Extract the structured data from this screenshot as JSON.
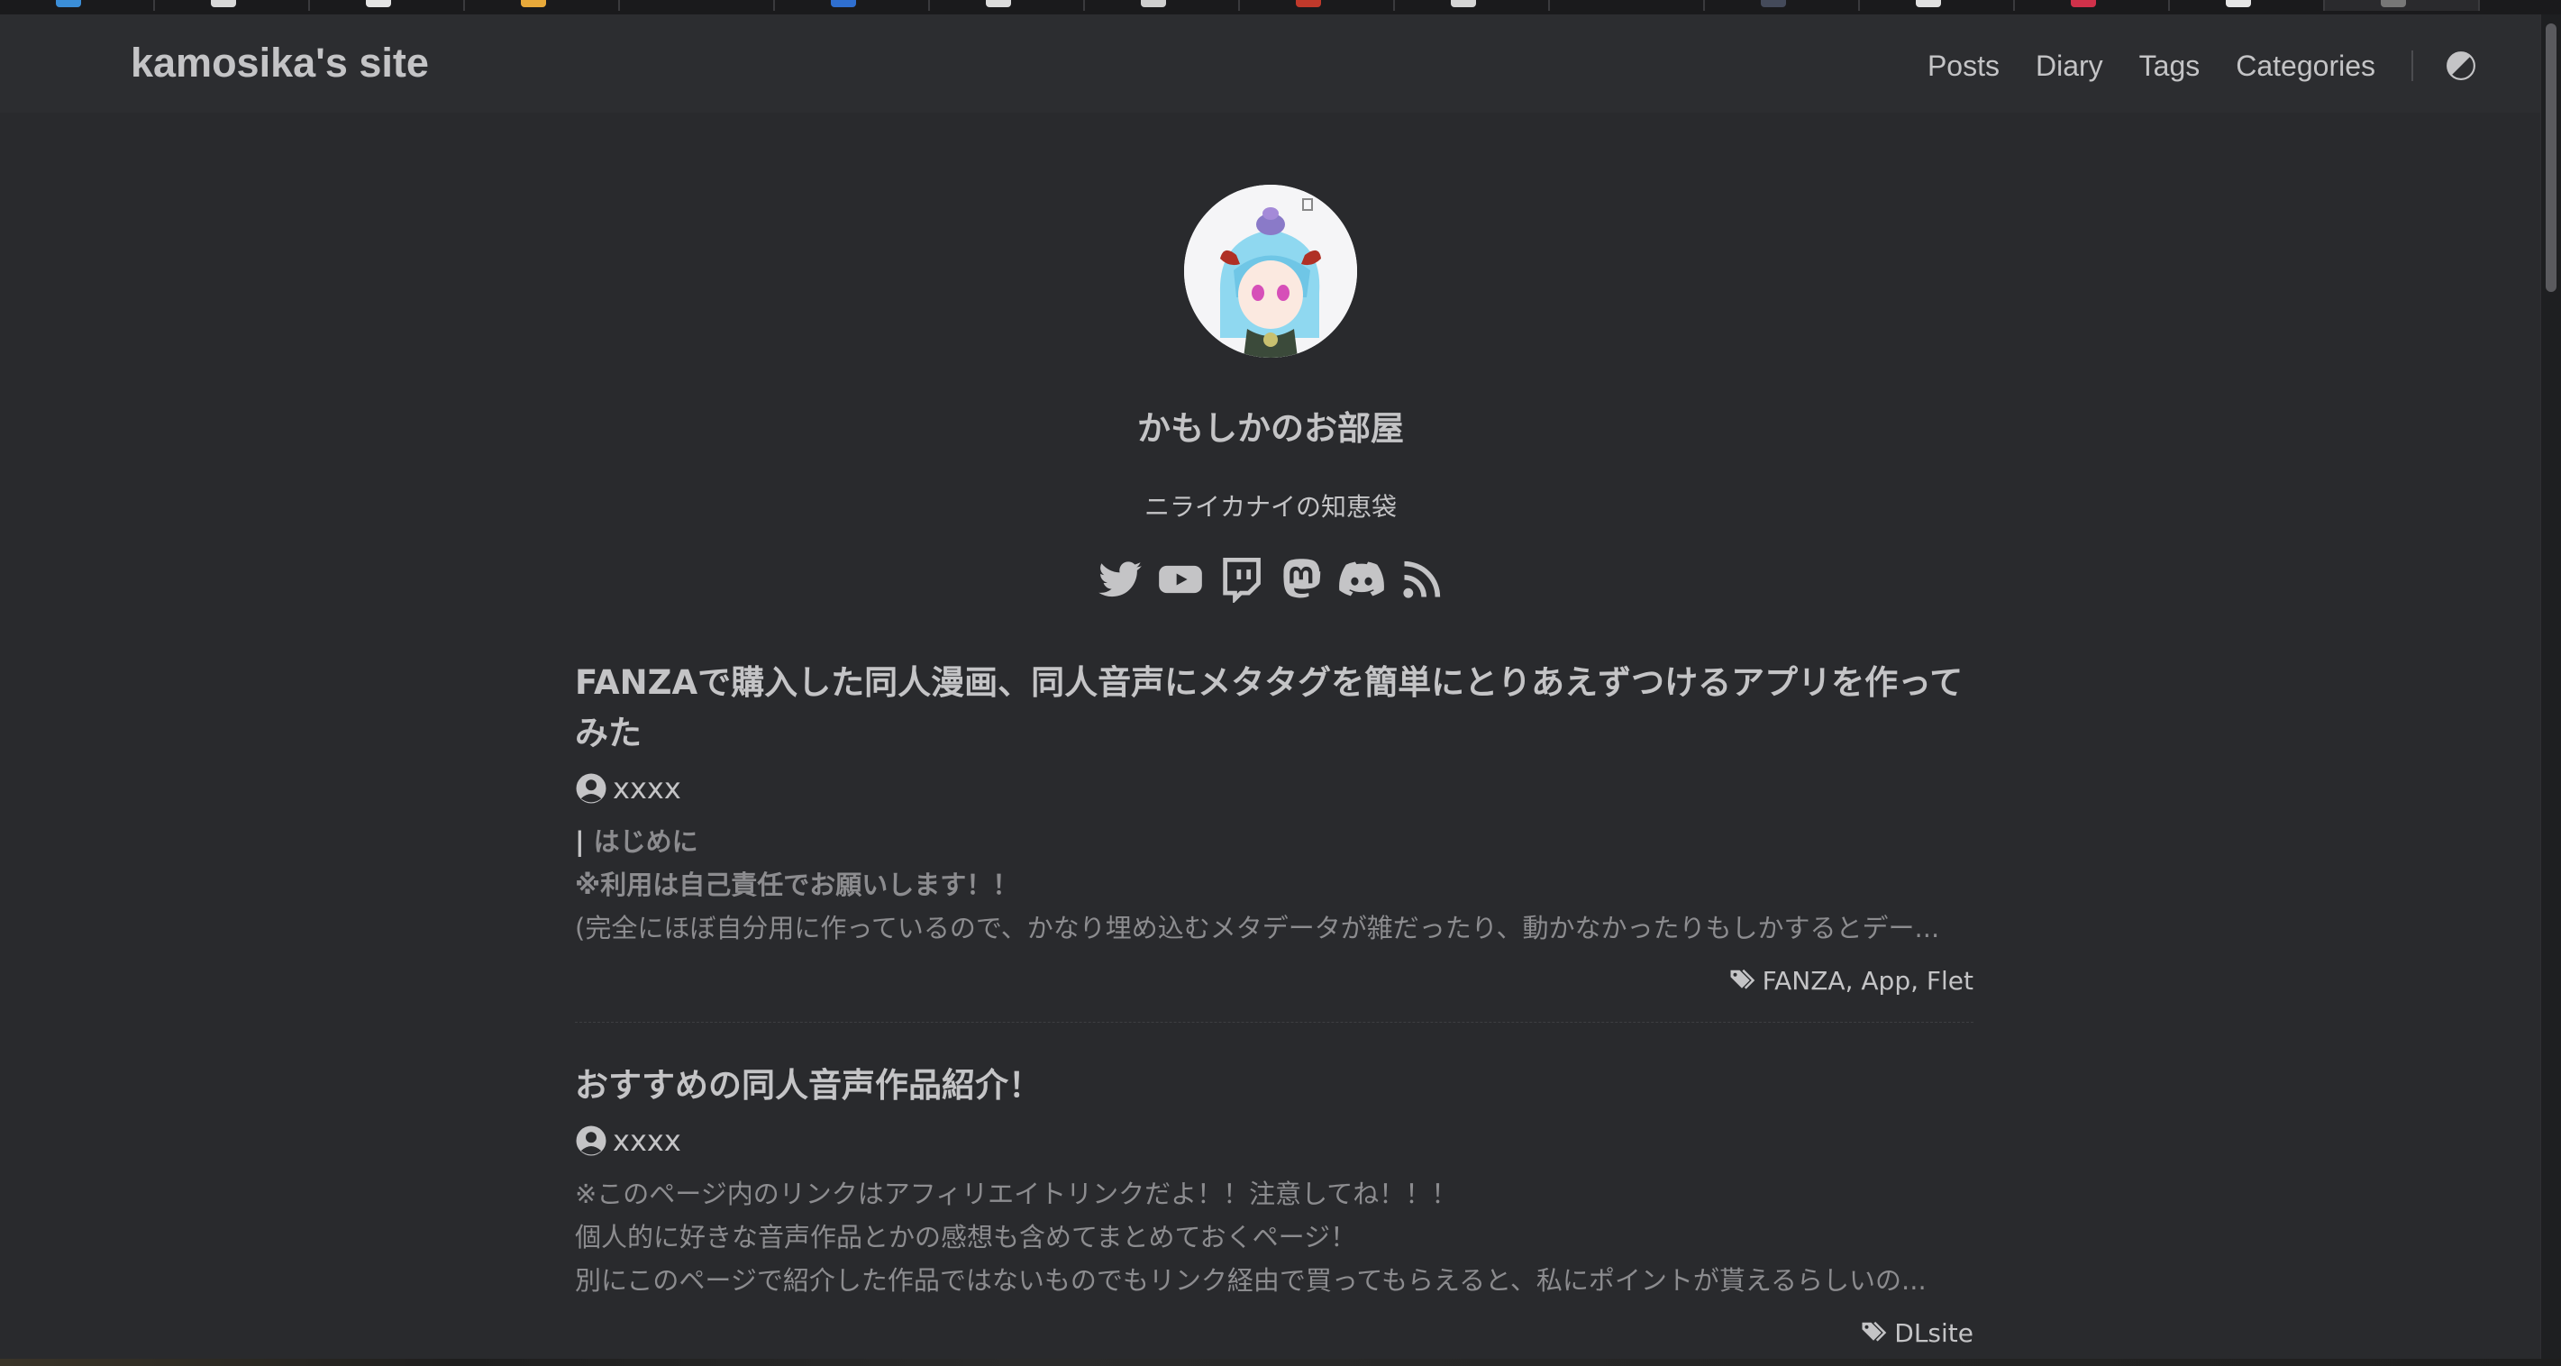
{
  "site": {
    "title": "kamosika's site"
  },
  "nav": [
    {
      "label": "Posts"
    },
    {
      "label": "Diary"
    },
    {
      "label": "Tags"
    },
    {
      "label": "Categories"
    }
  ],
  "profile": {
    "title": "かもしかのお部屋",
    "subtitle": "ニライカナイの知恵袋",
    "socials": [
      "twitter-icon",
      "youtube-icon",
      "twitch-icon",
      "mastodon-icon",
      "discord-icon",
      "rss-icon"
    ]
  },
  "posts": [
    {
      "title": "FANZAで購入した同人漫画、同人音声にメタタグを簡単にとりあえずつけるアプリを作ってみた",
      "author": "xxxx",
      "excerpt": {
        "heading": "はじめに",
        "lines": [
          "※利用は自己責任でお願いします！！",
          "(完全にほぼ自分用に作っているので、かなり埋め込むメタデータが雑だったり、動かなかったりもしかするとデー..."
        ]
      },
      "tags": [
        "FANZA",
        "App",
        "Flet"
      ]
    },
    {
      "title": "おすすめの同人音声作品紹介！",
      "author": "xxxx",
      "excerpt": {
        "lines": [
          "※このページ内のリンクはアフィリエイトリンクだよ！！注意してね！！！",
          "個人的に好きな音声作品とかの感想も含めてまとめておくページ！",
          "別にこのページで紹介した作品ではないものでもリンク経由で買ってもらえると、私にポイントが貰えるらしいの..."
        ]
      },
      "tags": [
        "DLsite"
      ]
    }
  ],
  "colors": {
    "background": "#292a2d",
    "header": "#2c2d30",
    "text": "#c4c4c6",
    "muted": "#8c8c8f"
  }
}
